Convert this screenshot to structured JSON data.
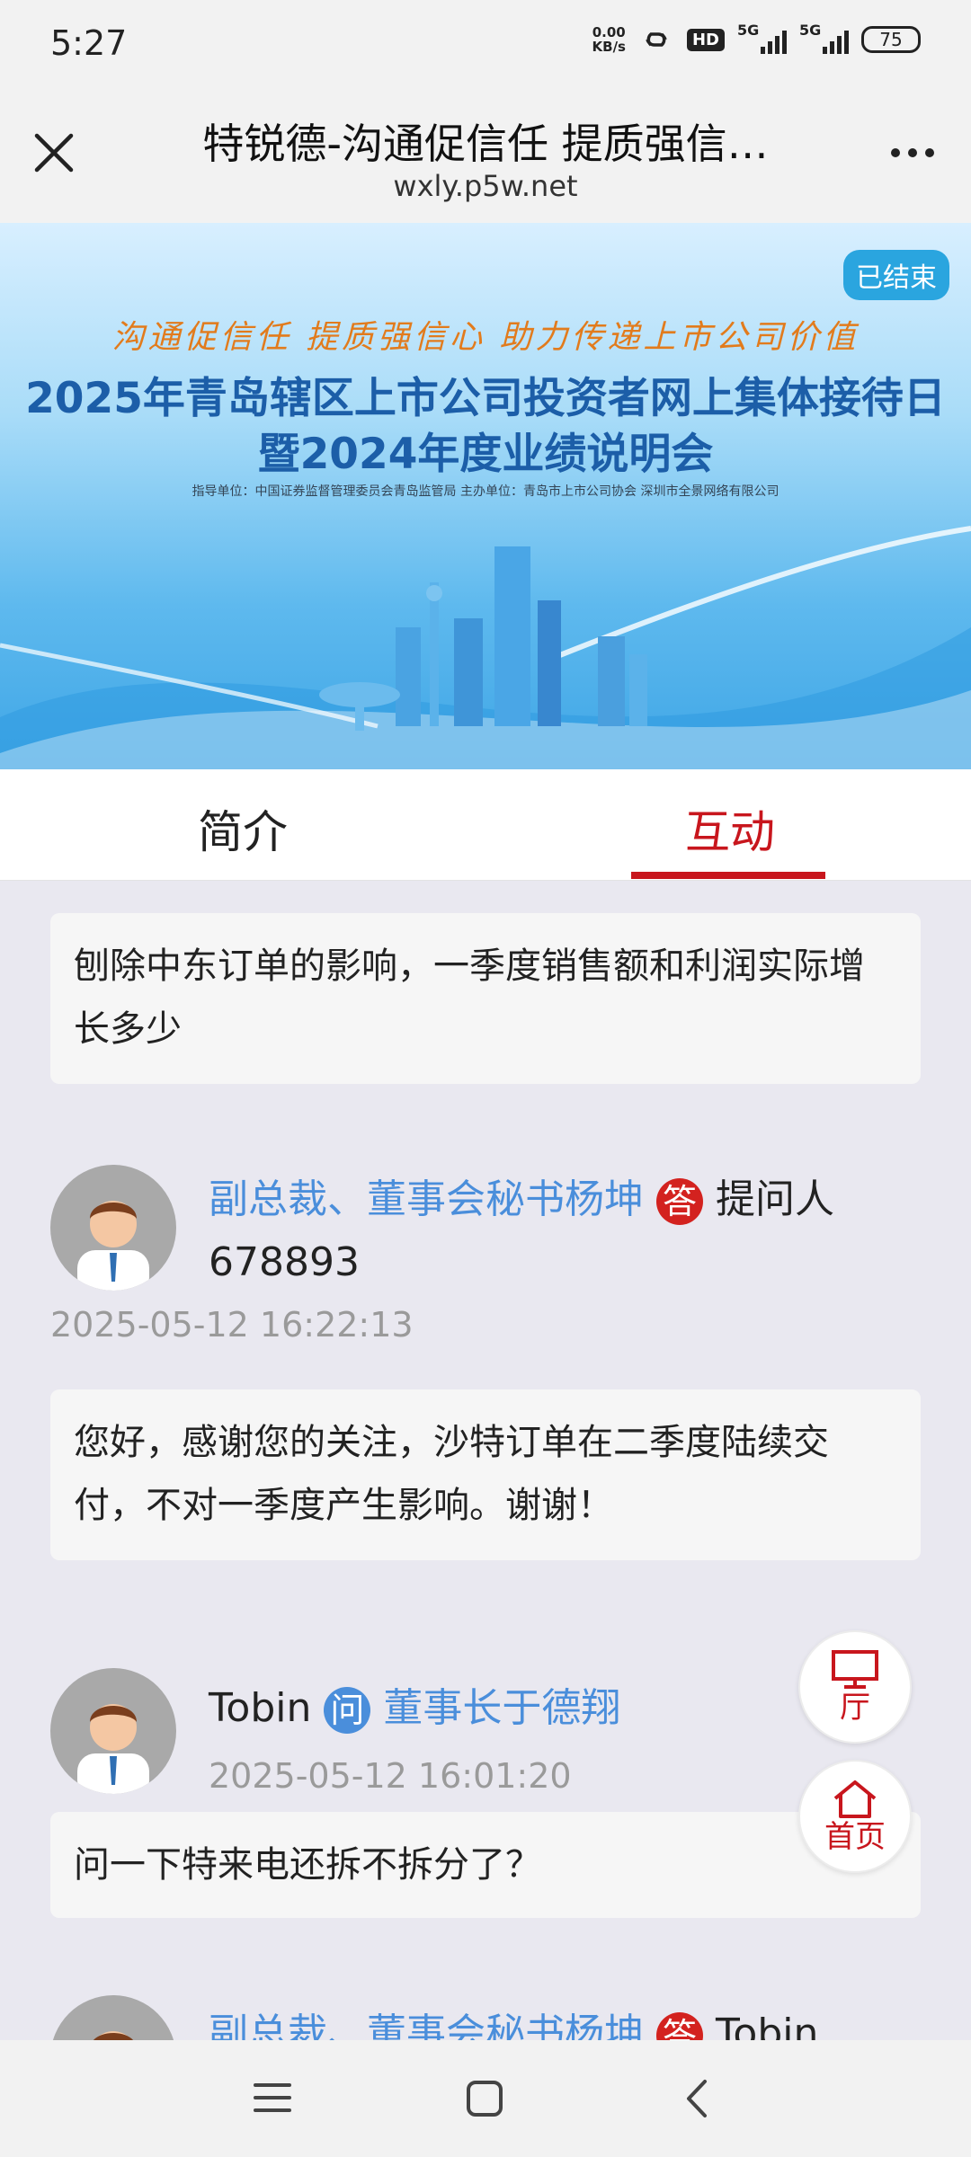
{
  "status_bar": {
    "time": "5:27",
    "net_speed_value": "0.00",
    "net_speed_unit": "KB/s",
    "hd_label": "HD",
    "signal1_label": "5G",
    "signal2_label": "5G",
    "battery": "75"
  },
  "header": {
    "title": "特锐德-沟通促信任 提质强信…",
    "url": "wxly.p5w.net"
  },
  "banner": {
    "status_badge": "已结束",
    "slogan": "沟通促信任  提质强信心  助力传递上市公司价值",
    "title_line1": "2025年青岛辖区上市公司投资者网上集体接待日",
    "title_line2": "暨2024年度业绩说明会",
    "org_line": "指导单位：中国证券监督管理委员会青岛监管局     主办单位：青岛市上市公司协会  深圳市全景网络有限公司"
  },
  "tabs": [
    {
      "label": "简介",
      "active": false
    },
    {
      "label": "互动",
      "active": true
    }
  ],
  "qa": [
    {
      "question_text": "刨除中东订单的影响，一季度销售额和利润实际增长多少",
      "answer": {
        "responder": "副总裁、董事会秘书杨坤",
        "badge": "答",
        "to_prefix": "提问人",
        "to_user": "678893",
        "time": "2025-05-12 16:22:13",
        "text": "您好，感谢您的关注，沙特订单在二季度陆续交付，不对一季度产生影响。谢谢！"
      }
    },
    {
      "asker": "Tobin",
      "badge": "问",
      "to": "董事长于德翔",
      "time": "2025-05-12 16:01:20",
      "question_text": "问一下特来电还拆不拆分了？",
      "partial_answer": {
        "responder": "副总裁、董事会秘书杨坤",
        "badge": "答",
        "to_user": "Tobin"
      }
    }
  ],
  "floating": {
    "hall_label": "厅",
    "home_label": "首页"
  },
  "colors": {
    "accent_red": "#c8161d",
    "link_blue": "#4a8edb",
    "card_bg": "#e9e8f0"
  }
}
